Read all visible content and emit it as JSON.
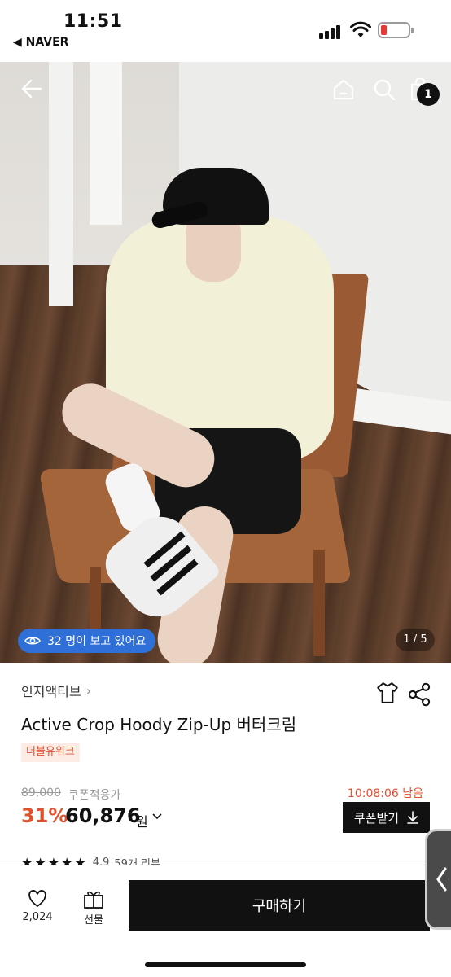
{
  "status_bar": {
    "time": "11:51",
    "back_app": "◀ NAVER",
    "battery_color": "#e53935"
  },
  "hero": {
    "bag_count": "1",
    "viewers": "32 명이 보고 있어요",
    "counter": "1 / 5",
    "icons": [
      "back-arrow-icon",
      "home-icon",
      "search-icon",
      "shopping-bag-icon"
    ]
  },
  "product": {
    "brand": "인지액티브",
    "title": "Active Crop Hoody Zip-Up 버터크림",
    "tag": "더블유위크",
    "original_price": "89,000",
    "coupon_note": "쿠폰적용가",
    "timer": "10:08:06 남음",
    "discount": "31%",
    "price": "60,876",
    "currency": "원",
    "coupon_button": "쿠폰받기",
    "rating": "4.9",
    "review_count": "59개 리뷰",
    "accent": "#e1522c"
  },
  "bottom_bar": {
    "like_count": "2,024",
    "gift_label": "선물",
    "buy_label": "구매하기"
  }
}
